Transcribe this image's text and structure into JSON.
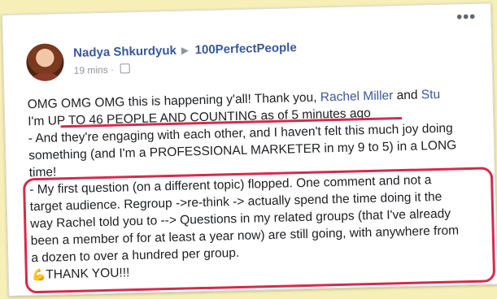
{
  "post": {
    "author": "Nadya Shkurdyuk",
    "group": "100PerfectPeople",
    "time": "19 mins",
    "more_label": "•••"
  },
  "content": {
    "line1_pre": "OMG OMG OMG this is happening y'all! Thank you, ",
    "mention1": "Rachel Miller",
    "line1_and": " and ",
    "mention2": "Stu",
    "line2": "I'm UP TO 46 PEOPLE AND COUNTING as of 5 minutes ago",
    "line3": "- And they're engaging with each other, and I haven't felt this much joy doing",
    "line4": "something (and I'm a PROFESSIONAL MARKETER in my 9 to 5) in a LONG",
    "line5": "time!",
    "line6": "- My first question (on a different topic) flopped. One comment and not a",
    "line7": "target audience. Regroup ->re-think -> actually spend the time doing it the",
    "line8": "way Rachel told you to --> Questions in my related groups (that I've already",
    "line9": "been a member of for at least a year now) are still going, with anywhere from",
    "line10": "a dozen to over a hundred per group.",
    "thanks": "THANK YOU!!!",
    "muscle_emoji": "💪"
  },
  "colors": {
    "background": "#f6efb7",
    "link": "#385898",
    "highlight": "#d62a4b"
  }
}
